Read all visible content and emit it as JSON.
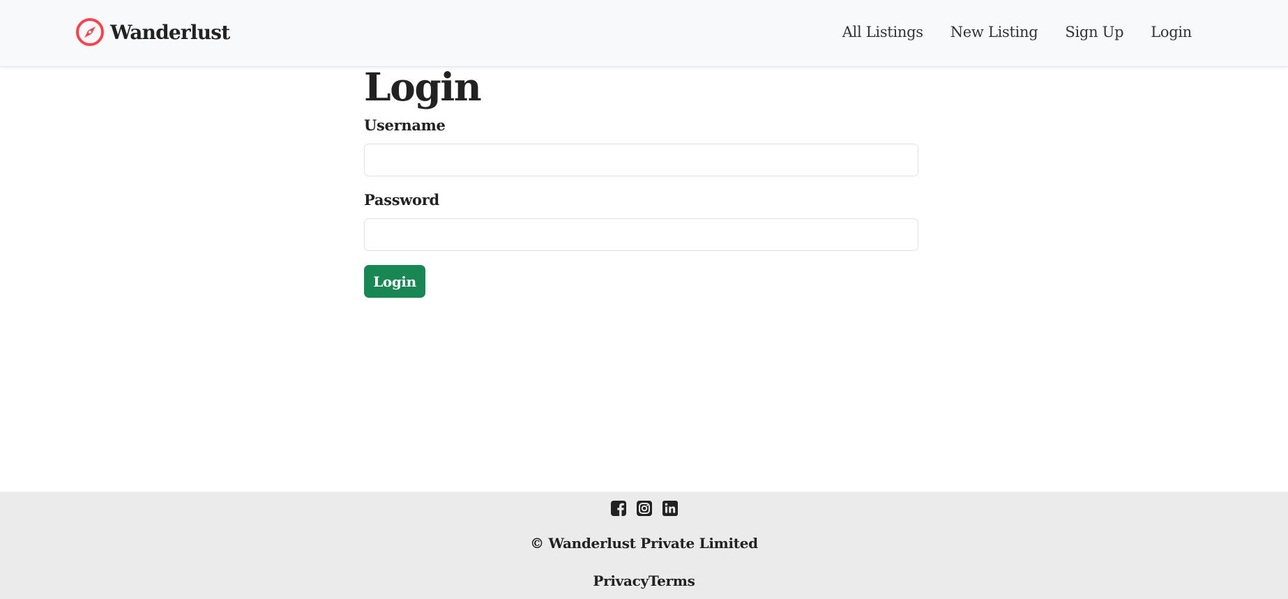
{
  "brand": {
    "name": "Wanderlust",
    "icon": "compass-icon",
    "color": "#fe424d"
  },
  "nav": {
    "links": [
      {
        "label": "All Listings"
      },
      {
        "label": "New Listing"
      },
      {
        "label": "Sign Up"
      },
      {
        "label": "Login"
      }
    ]
  },
  "form": {
    "title": "Login",
    "username": {
      "label": "Username",
      "value": "",
      "placeholder": ""
    },
    "password": {
      "label": "Password",
      "value": "",
      "placeholder": ""
    },
    "submit_label": "Login",
    "submit_color": "#198754"
  },
  "footer": {
    "social": [
      {
        "icon": "facebook-icon"
      },
      {
        "icon": "instagram-icon"
      },
      {
        "icon": "linkedin-icon"
      }
    ],
    "copyright": "© Wanderlust Private Limited",
    "links": [
      {
        "label": "Privacy"
      },
      {
        "label": "Terms"
      }
    ],
    "background": "#ebebeb"
  }
}
